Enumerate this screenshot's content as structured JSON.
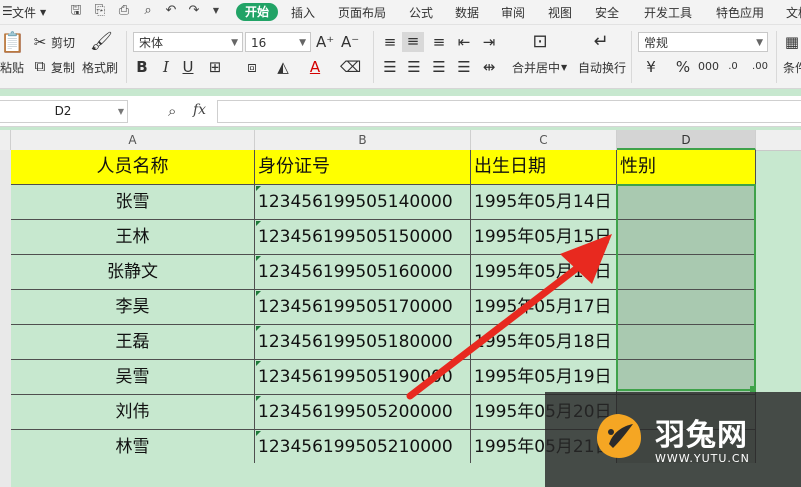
{
  "menu": {
    "file": "文件",
    "tabs": [
      "开始",
      "插入",
      "页面布局",
      "公式",
      "数据",
      "审阅",
      "视图",
      "安全",
      "开发工具",
      "特色应用",
      "文档"
    ]
  },
  "toolbar": {
    "paste": "粘贴",
    "cut": "剪切",
    "copy": "复制",
    "format_painter": "格式刷",
    "font_name": "宋体",
    "font_size": "16",
    "merge_center": "合并居中",
    "wrap_text": "自动换行",
    "number_format": "常规",
    "conditional": "条件"
  },
  "formula_bar": {
    "name_box": "D2",
    "fx": "fx",
    "value": ""
  },
  "columns": [
    "A",
    "B",
    "C",
    "D"
  ],
  "sheet": {
    "header": [
      "人员名称",
      "身份证号",
      "出生日期",
      "性别"
    ],
    "rows": [
      {
        "name": "张雪",
        "id": "123456199505140000",
        "date": "1995年05月14日",
        "gender": ""
      },
      {
        "name": "王林",
        "id": "123456199505150000",
        "date": "1995年05月15日",
        "gender": ""
      },
      {
        "name": "张静文",
        "id": "123456199505160000",
        "date": "1995年05月16日",
        "gender": ""
      },
      {
        "name": "李昊",
        "id": "123456199505170000",
        "date": "1995年05月17日",
        "gender": ""
      },
      {
        "name": "王磊",
        "id": "123456199505180000",
        "date": "1995年05月18日",
        "gender": ""
      },
      {
        "name": "吴雪",
        "id": "123456199505190000",
        "date": "1995年05月19日",
        "gender": ""
      },
      {
        "name": "刘伟",
        "id": "123456199505200000",
        "date": "1995年05月20日",
        "gender": ""
      },
      {
        "name": "林雪",
        "id": "123456199505210000",
        "date": "1995年05月21日",
        "gender": ""
      }
    ]
  },
  "watermark": {
    "brand": "羽兔网",
    "url": "WWW.YUTU.CN"
  },
  "colors": {
    "accent": "#21a366",
    "header_fill": "#ffff00",
    "sheet_bg": "#c7e8cf",
    "arrow": "#e8291f"
  }
}
